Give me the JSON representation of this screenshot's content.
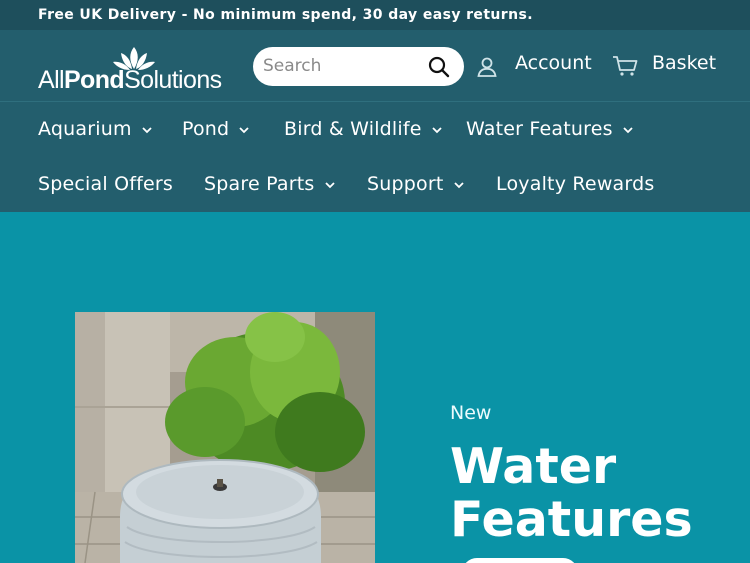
{
  "announcement": {
    "text": "Free UK Delivery - No minimum spend, 30 day easy returns."
  },
  "header": {
    "logo": {
      "part1": "All",
      "part2": "Pond",
      "part3": "Solutions"
    },
    "search": {
      "placeholder": "Search"
    },
    "account_label": "Account",
    "basket_label": "Basket"
  },
  "nav": {
    "row1": [
      {
        "label": "Aquarium",
        "dropdown": true
      },
      {
        "label": "Pond",
        "dropdown": true
      },
      {
        "label": "Bird & Wildlife",
        "dropdown": true
      },
      {
        "label": "Water Features",
        "dropdown": true
      }
    ],
    "row2": [
      {
        "label": "Special Offers",
        "dropdown": false
      },
      {
        "label": "Spare Parts",
        "dropdown": true
      },
      {
        "label": "Support",
        "dropdown": true
      },
      {
        "label": "Loyalty Rewards",
        "dropdown": false
      }
    ]
  },
  "hero": {
    "eyebrow": "New",
    "title_line1": "Water",
    "title_line2": "Features"
  },
  "colors": {
    "announcement_bg": "#1e4f5c",
    "header_bg": "#235e6d",
    "hero_bg": "#0a93a6"
  }
}
